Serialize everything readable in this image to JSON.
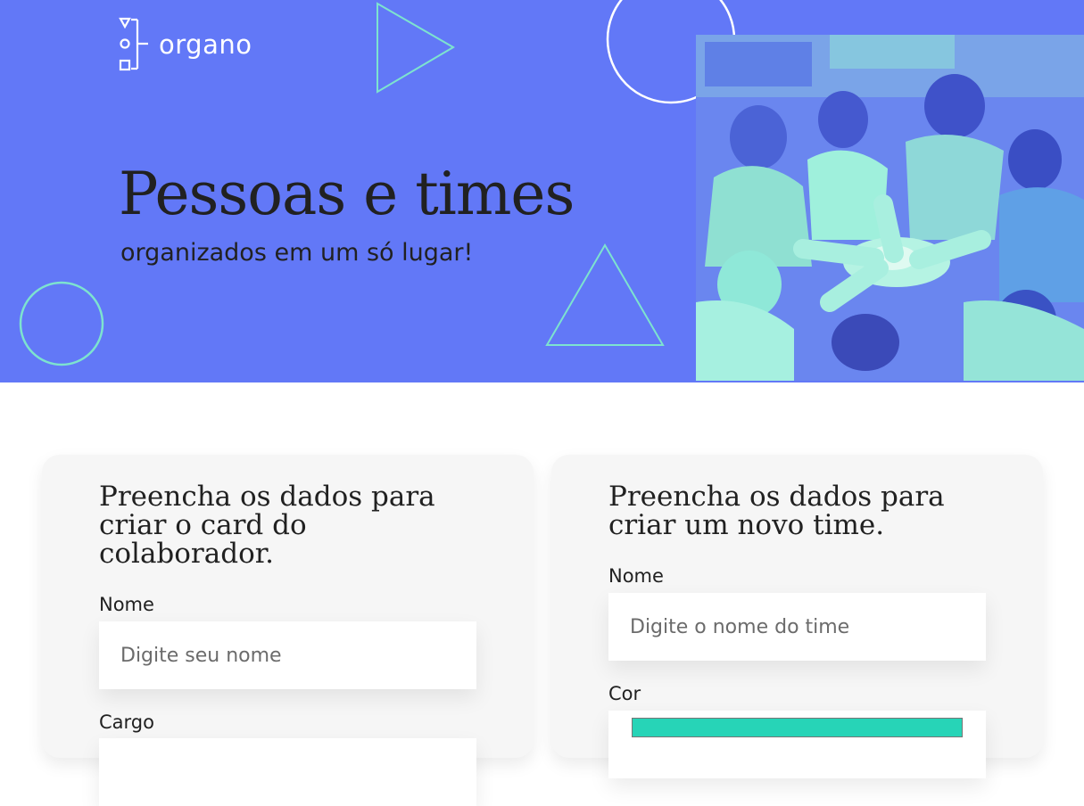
{
  "header": {
    "logo_text": "organo",
    "title": "Pessoas e times",
    "subtitle": "organizados em um só lugar!",
    "banner_color": "#6278f7",
    "accent_color": "#7de3cf",
    "photo_description_icon": "team-hands-photo"
  },
  "collaborator_form": {
    "title": "Preencha os dados para criar o card do colaborador.",
    "title_lines": [
      "Preencha os dados para",
      "criar o card do",
      "colaborador."
    ],
    "name_label": "Nome",
    "name_placeholder": "Digite seu nome",
    "role_label": "Cargo"
  },
  "team_form": {
    "title_lines": [
      "Preencha os dados para",
      "criar um novo time."
    ],
    "name_label": "Nome",
    "name_placeholder": "Digite o nome do time",
    "color_label": "Cor",
    "color_value": "#27d4b7"
  }
}
